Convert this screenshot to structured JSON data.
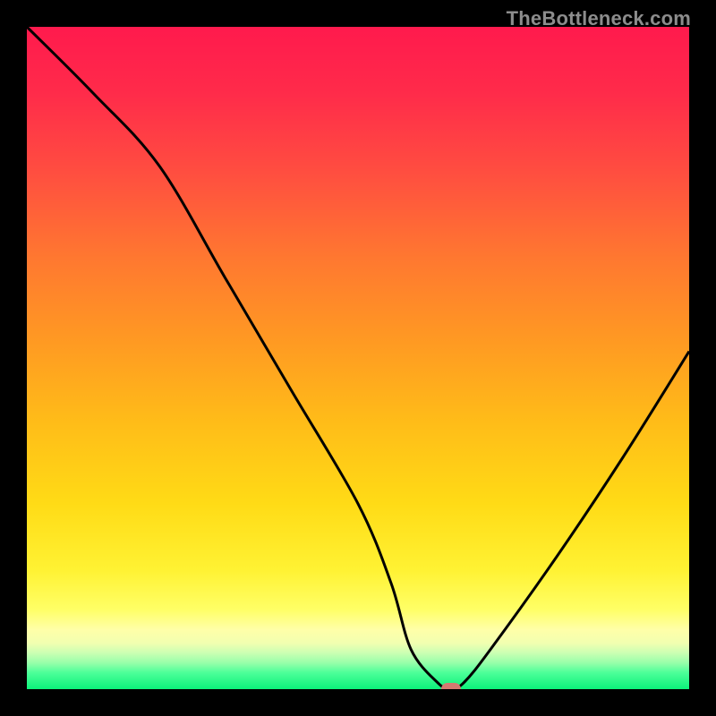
{
  "watermark": "TheBottleneck.com",
  "marker": {
    "x_pct": 64,
    "y_pct": 99
  },
  "chart_data": {
    "type": "line",
    "title": "",
    "xlabel": "",
    "ylabel": "",
    "xlim": [
      0,
      100
    ],
    "ylim": [
      0,
      100
    ],
    "grid": false,
    "legend": false,
    "background": "rainbow-vertical-gradient (red top → green bottom)",
    "series": [
      {
        "name": "bottleneck-curve",
        "x": [
          0,
          10,
          20,
          30,
          40,
          50,
          55,
          58,
          62,
          64,
          66,
          70,
          80,
          90,
          100
        ],
        "y": [
          100,
          90,
          79,
          62,
          45,
          28,
          16,
          6,
          1,
          0,
          1,
          6,
          20,
          35,
          51
        ]
      }
    ],
    "marker_point": {
      "x": 64,
      "y": 0,
      "color": "#d47a70"
    }
  }
}
